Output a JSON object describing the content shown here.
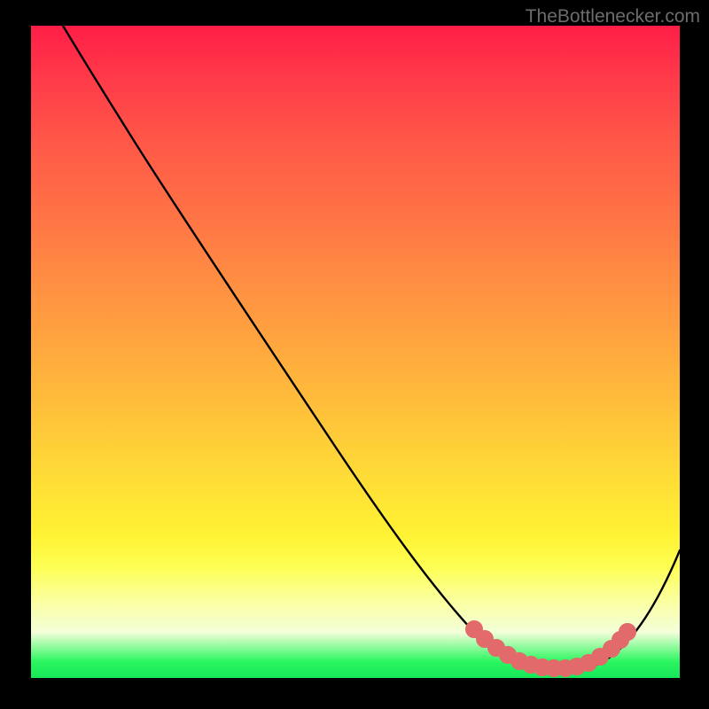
{
  "watermark": "TheBottlenecker.com",
  "chart_data": {
    "type": "line",
    "title": "",
    "xlabel": "",
    "ylabel": "",
    "xlim": [
      0,
      100
    ],
    "ylim": [
      0,
      100
    ],
    "curve": {
      "name": "bottleneck-curve",
      "x": [
        5,
        10,
        15,
        20,
        25,
        30,
        35,
        40,
        45,
        50,
        55,
        60,
        63,
        67,
        71,
        75,
        78,
        81,
        84,
        88,
        92,
        96,
        100
      ],
      "y": [
        100,
        94,
        86,
        79,
        72,
        65,
        58,
        51,
        44,
        37,
        30,
        22,
        16,
        11,
        7,
        4,
        2,
        1,
        1,
        2,
        6,
        13,
        22
      ]
    },
    "optimum_band": {
      "name": "optimum-range-markers",
      "color": "#e26a6a",
      "x_pct": [
        69,
        70.5,
        72,
        73.5,
        75,
        76.5,
        78,
        79.5,
        81,
        82.5,
        84,
        85.5,
        87,
        88.5,
        90
      ],
      "y_pct_from_bottom": [
        7.5,
        6.2,
        5.1,
        4.2,
        3.4,
        2.7,
        2.3,
        2.0,
        1.9,
        2.0,
        2.4,
        3.0,
        3.9,
        5.0,
        6.4
      ]
    },
    "gradient_stops": [
      {
        "pct": 0,
        "color": "#ff1e47"
      },
      {
        "pct": 48,
        "color": "#ffa43f"
      },
      {
        "pct": 78,
        "color": "#fff233"
      },
      {
        "pct": 97.5,
        "color": "#2bf65f"
      },
      {
        "pct": 100,
        "color": "#16e65a"
      }
    ]
  }
}
